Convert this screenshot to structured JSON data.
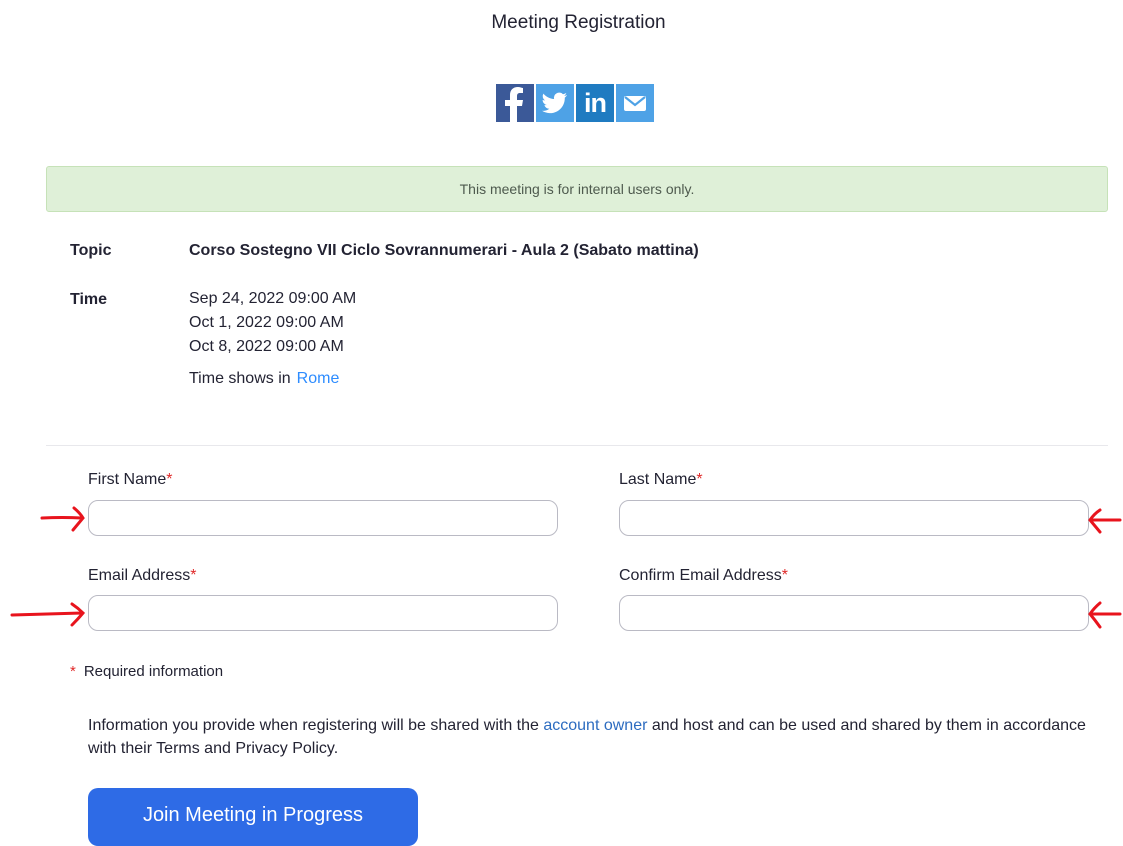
{
  "page": {
    "title": "Meeting Registration"
  },
  "share": {
    "buttons": [
      {
        "name": "facebook",
        "icon": "facebook-icon",
        "color": "#3b5998"
      },
      {
        "name": "twitter",
        "icon": "twitter-icon",
        "color": "#4ea2e6"
      },
      {
        "name": "linkedin",
        "icon": "linkedin-icon",
        "color": "#1f7bc1"
      },
      {
        "name": "email",
        "icon": "email-icon",
        "color": "#4ea2e6"
      }
    ],
    "linkedin_text": "in"
  },
  "banner": {
    "text": "This meeting is for internal users only."
  },
  "meeting": {
    "topic_label": "Topic",
    "topic": "Corso Sostegno VII Ciclo Sovrannumerari - Aula 2 (Sabato mattina)",
    "time_label": "Time",
    "times": [
      "Sep 24, 2022 09:00 AM",
      "Oct 1, 2022 09:00 AM",
      "Oct 8, 2022 09:00 AM"
    ],
    "tz_prefix": "Time shows in",
    "tz_link": "Rome"
  },
  "form": {
    "required_mark": "*",
    "first_name": {
      "label": "First Name",
      "value": ""
    },
    "last_name": {
      "label": "Last Name",
      "value": ""
    },
    "email": {
      "label": "Email Address",
      "value": ""
    },
    "confirm_email": {
      "label": "Confirm Email Address",
      "value": ""
    },
    "required_info": "Required information"
  },
  "privacy": {
    "before": "Information you provide when registering will be shared with the",
    "link": "account owner",
    "after": "and host and can be used and shared by them in accordance with their Terms and Privacy Policy."
  },
  "join_button": {
    "label": "Join Meeting in Progress"
  },
  "colors": {
    "accent": "#2e6be6",
    "link": "#2d8cff",
    "banner_bg": "#dff0d8",
    "required": "#e02828",
    "annotation": "#e8141d"
  }
}
